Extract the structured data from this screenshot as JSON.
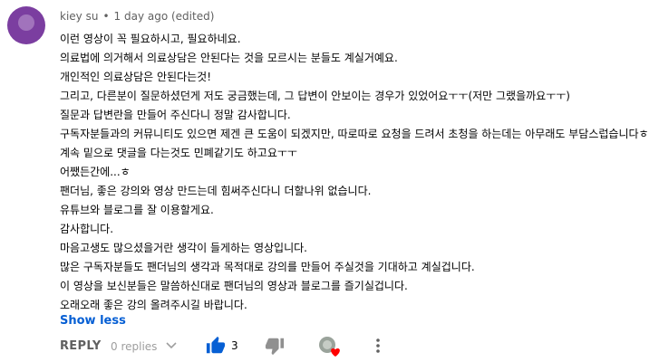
{
  "comment": {
    "author": "kiey su",
    "separator": "•",
    "timestamp": "1 day ago (edited)",
    "lines": [
      "이런 영상이 꼭 필요하시고, 필요하네요.",
      "의료법에 의거해서 의료상담은 안된다는 것을 모르시는 분들도 계실거예요.",
      "개인적인 의료상담은 안된다는것!",
      "그리고, 다른분이 질문하셨던게 저도 궁금했는데, 그 답변이 안보이는 경우가 있었어요ㅜㅜ(저만 그랬을까요ㅜㅜ)",
      "질문과 답변란을 만들어 주신다니 정말 감사합니다.",
      "구독자분들과의 커뮤니티도 있으면 제겐 큰 도움이 되겠지만, 따로따로 요청을 드려서 초청을 하는데는 아무래도 부담스럽습니다ㅎ",
      "계속 밑으로 댓글을 다는것도 민폐같기도 하고요ㅜㅜ",
      "어쨌든간에...ㅎ",
      "팬더님, 좋은 강의와 영상 만드는데 힘써주신다니 더할나위 없습니다.",
      "유튜브와 블로그를 잘 이용할게요.",
      "감사합니다.",
      "마음고생도 많으셨을거란 생각이 들게하는 영상입니다.",
      "많은 구독자분들도 팬더님의 생각과 목적대로 강의를 만들어 주실것을 기대하고 계실겁니다.",
      "이 영상을 보신분들은 말씀하신대로 팬더님의 영상과 블로그를 즐기실겁니다.",
      "오래오래 좋은 강의 올려주시길 바랍니다."
    ],
    "show_less": "Show less",
    "actions": {
      "reply": "REPLY",
      "replies": "0 replies",
      "like_count": "3"
    }
  },
  "icons": {
    "expand": "chevron-down-icon",
    "like": "thumbs-up-icon",
    "dislike": "thumbs-down-icon",
    "creator_heart": "creator-heart-icon",
    "more": "more-vert-icon"
  },
  "colors": {
    "link": "#065fd4",
    "like_active": "#065fd4",
    "heart": "#ff0000",
    "avatar": "#7b3ea0"
  }
}
